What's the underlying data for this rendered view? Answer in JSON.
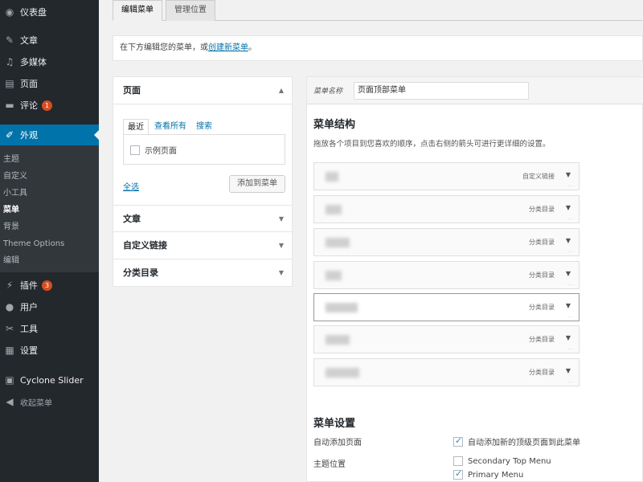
{
  "sidebar": {
    "items": [
      {
        "label": "仪表盘",
        "icon": "dashboard-icon",
        "glyph": "◉"
      },
      {
        "label": "文章",
        "icon": "pin-icon",
        "glyph": "✎"
      },
      {
        "label": "多媒体",
        "icon": "media-icon",
        "glyph": "♫"
      },
      {
        "label": "页面",
        "icon": "pages-icon",
        "glyph": "▤"
      },
      {
        "label": "评论",
        "icon": "comment-icon",
        "glyph": "▬",
        "badge": "1"
      },
      {
        "label": "外观",
        "icon": "appearance-icon",
        "glyph": "✐"
      },
      {
        "label": "插件",
        "icon": "plugin-icon",
        "glyph": "⚡",
        "badge": "3"
      },
      {
        "label": "用户",
        "icon": "user-icon",
        "glyph": "●"
      },
      {
        "label": "工具",
        "icon": "wrench-icon",
        "glyph": "✂"
      },
      {
        "label": "设置",
        "icon": "settings-icon",
        "glyph": "▦"
      },
      {
        "label": "Cyclone Slider",
        "icon": "slider-icon",
        "glyph": "▣"
      },
      {
        "label": "收起菜单",
        "icon": "collapse-icon",
        "glyph": "◀"
      }
    ],
    "submenu": [
      "主题",
      "自定义",
      "小工具",
      "菜单",
      "背景",
      "Theme Options",
      "编辑"
    ]
  },
  "tabs": [
    "编辑菜单",
    "管理位置"
  ],
  "notice": {
    "prefix": "在下方编辑您的菜单，或",
    "link": "创建新菜单",
    "suffix": "。"
  },
  "left_panel": {
    "pages_title": "页面",
    "inner_tabs": [
      "最近",
      "查看所有",
      "搜索"
    ],
    "sample_page": "示例页面",
    "select_all": "全选",
    "add_button": "添加到菜单",
    "sections": [
      "文章",
      "自定义链接",
      "分类目录"
    ]
  },
  "right_panel": {
    "name_label": "菜单名称",
    "name_value": "页面顶部菜单",
    "structure_title": "菜单结构",
    "structure_desc": "拖放各个项目到您喜欢的顺序，点击右侧的箭头可进行更详细的设置。",
    "items": [
      {
        "type": "自定义链接"
      },
      {
        "type": "分类目录"
      },
      {
        "type": "分类目录"
      },
      {
        "type": "分类目录"
      },
      {
        "type": "分类目录"
      },
      {
        "type": "分类目录"
      },
      {
        "type": "分类目录"
      }
    ],
    "settings_title": "菜单设置",
    "auto_add_label": "自动添加页面",
    "auto_add_option": "自动添加新的顶级页面到此菜单",
    "location_label": "主题位置",
    "locations": [
      {
        "label": "Secondary Top Menu",
        "checked": false
      },
      {
        "label": "Primary Menu",
        "checked": true
      }
    ]
  }
}
